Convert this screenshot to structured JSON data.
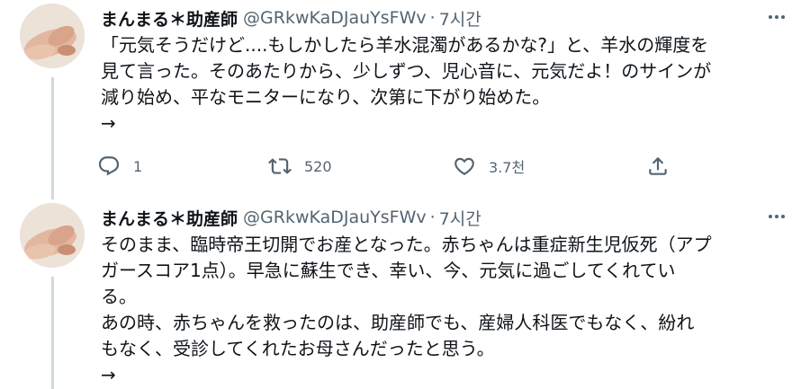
{
  "tweets": [
    {
      "author_name": "まんまる＊助産師",
      "handle": "@GRkwKaDJauYsFWv",
      "separator": "·",
      "time": "7시간",
      "text": "「元気そうだけど....もしかしたら羊水混濁があるかな?」と、羊水の輝度を\n見て言った。そのあたりから、少しずつ、児心音に、元気だよ！のサインが\n減り始め、平なモニターになり、次第に下がり始めた。\n→",
      "actions": {
        "reply_count": "1",
        "retweet_count": "520",
        "like_count": "3.7천"
      }
    },
    {
      "author_name": "まんまる＊助産師",
      "handle": "@GRkwKaDJauYsFWv",
      "separator": "·",
      "time": "7시간",
      "text": "そのまま、臨時帝王切開でお産となった。赤ちゃんは重症新生児仮死（アプ\nガースコア1点）。早急に蘇生でき、幸い、今、元気に過ごしてくれてい\nる。\nあの時、赤ちゃんを救ったのは、助産師でも、産婦人科医でもなく、紛れ\nもなく、受診してくれたお母さんだったと思う。\n→"
    }
  ],
  "icons": {
    "reply": "reply-icon",
    "retweet": "retweet-icon",
    "like": "heart-icon",
    "share": "share-icon",
    "more": "more-options-icon"
  },
  "colors": {
    "text": "#0f1419",
    "secondary": "#536471",
    "thread_line": "#cfd9de"
  }
}
